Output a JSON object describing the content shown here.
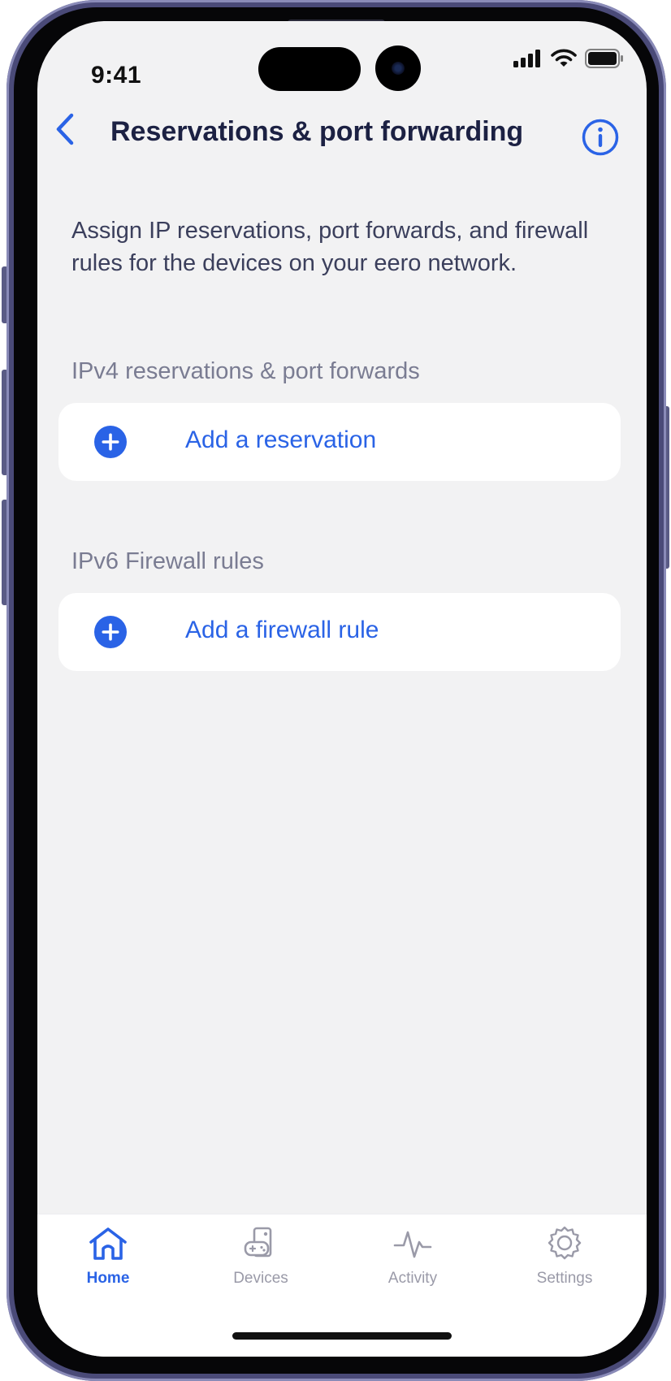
{
  "status_bar": {
    "time": "9:41"
  },
  "header": {
    "title": "Reservations & port forwarding"
  },
  "description": "Assign IP reservations, port forwards, and firewall rules for the devices on your eero network.",
  "sections": [
    {
      "label": "IPv4 reservations & port forwards",
      "action": "Add a reservation"
    },
    {
      "label": "IPv6 Firewall rules",
      "action": "Add a firewall rule"
    }
  ],
  "tabs": [
    {
      "label": "Home",
      "icon": "home-icon",
      "active": true
    },
    {
      "label": "Devices",
      "icon": "devices-icon",
      "active": false
    },
    {
      "label": "Activity",
      "icon": "activity-icon",
      "active": false
    },
    {
      "label": "Settings",
      "icon": "gear-icon",
      "active": false
    }
  ],
  "colors": {
    "accent": "#2a63e6",
    "title": "#1c2143",
    "inactive_tab": "#9a9aa8",
    "background": "#f2f2f3"
  }
}
